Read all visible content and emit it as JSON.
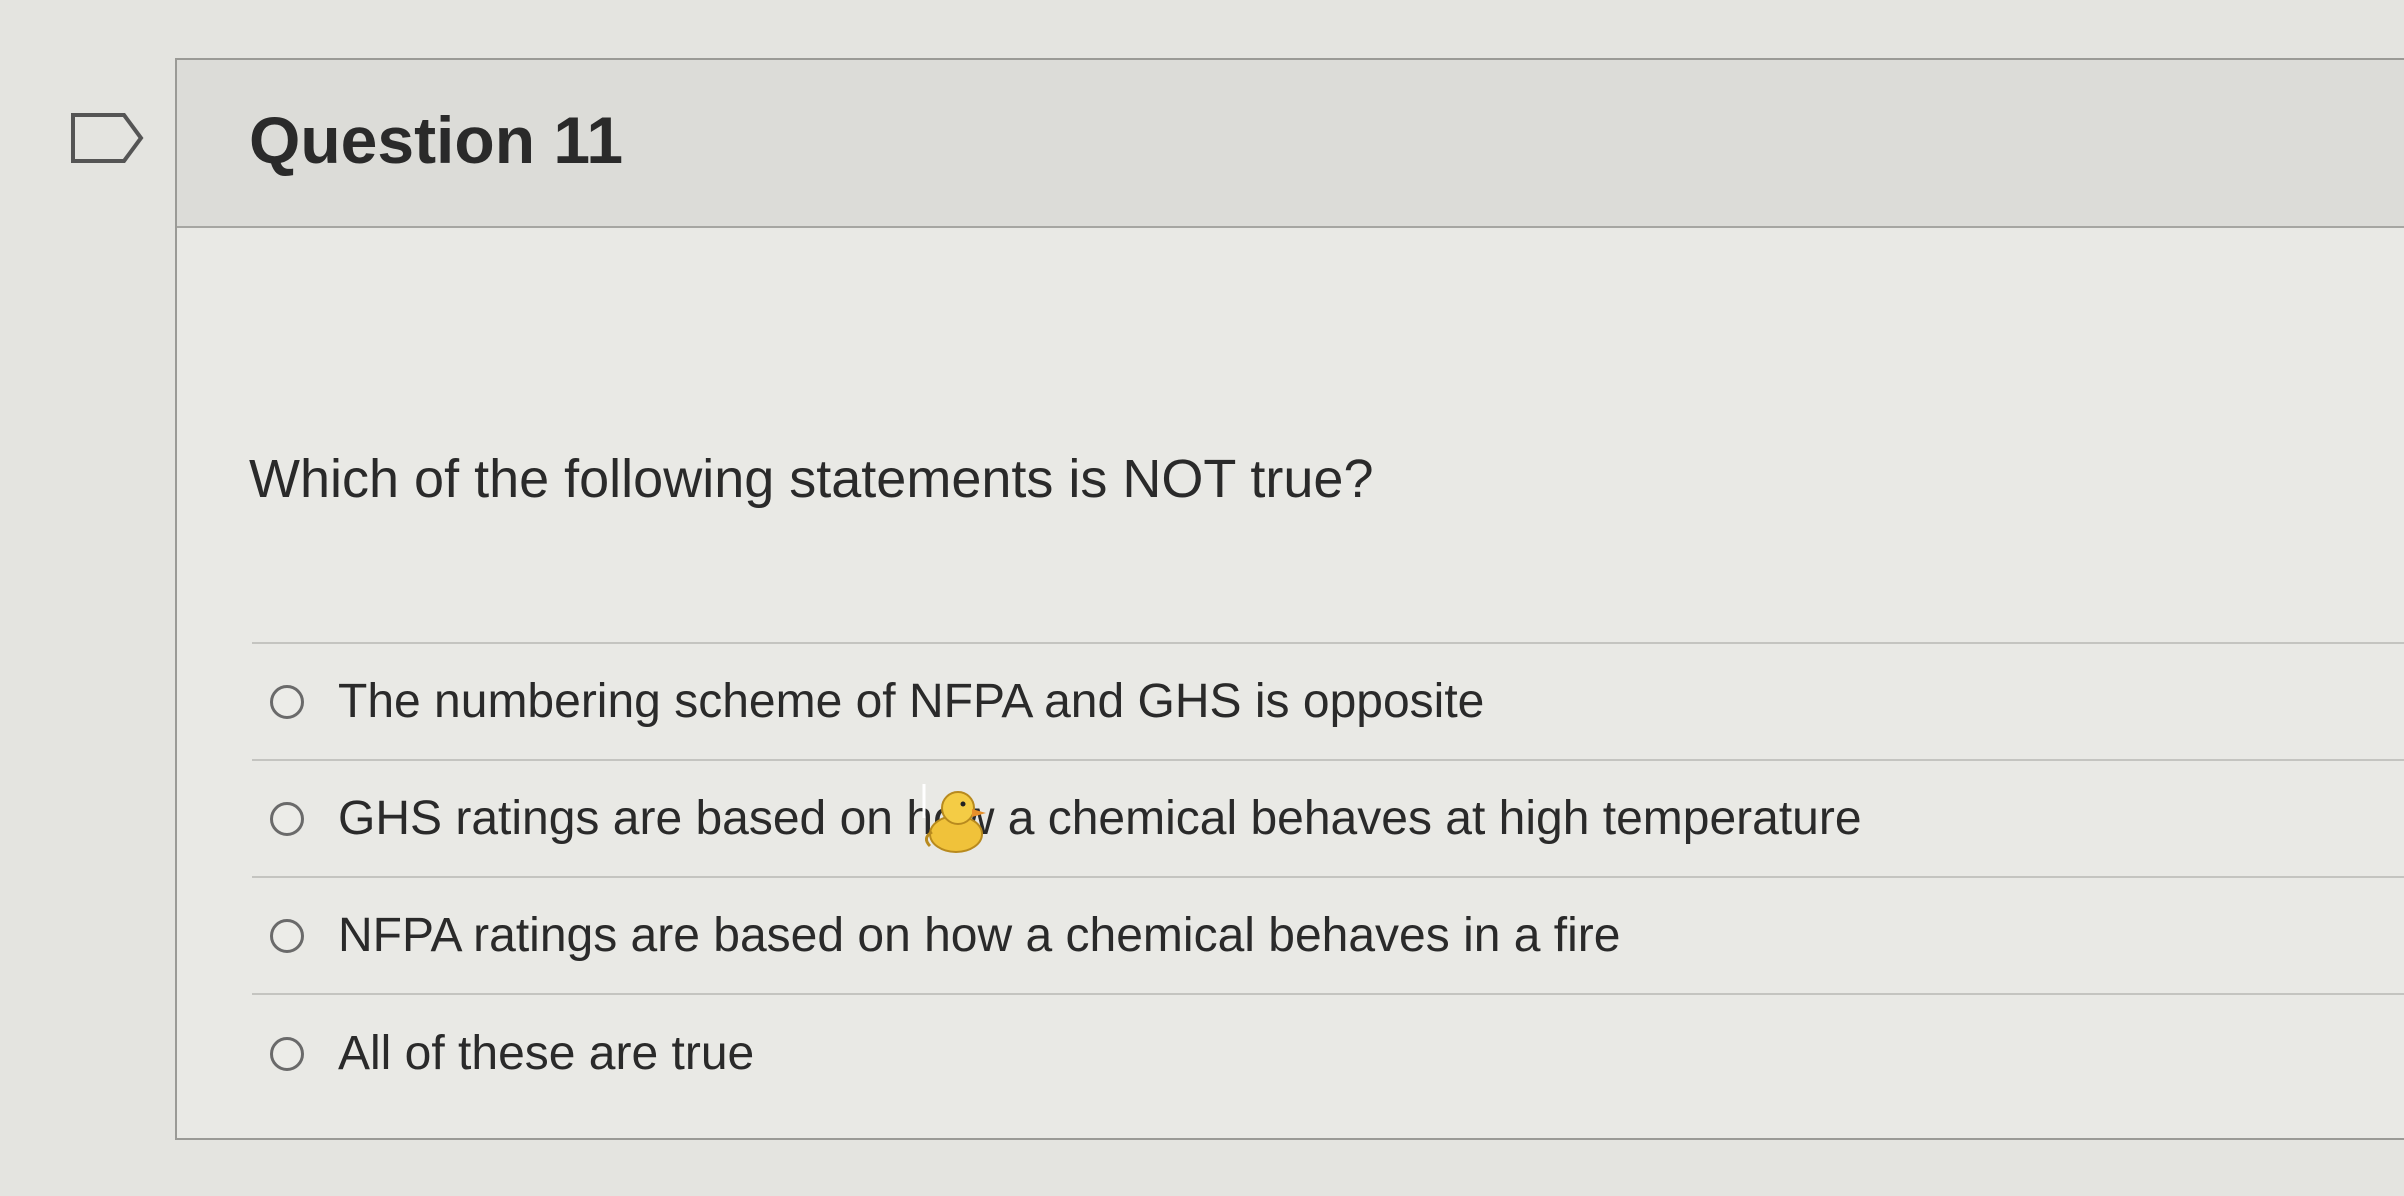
{
  "question": {
    "title": "Question 11",
    "prompt": "Which of the following statements is NOT true?"
  },
  "answers": [
    {
      "label": "The numbering scheme of NFPA and GHS is opposite",
      "selected": false
    },
    {
      "label": "GHS ratings are based on how a chemical behaves at high temperature",
      "selected": false
    },
    {
      "label": "NFPA ratings are based on how a chemical behaves in a fire",
      "selected": false
    },
    {
      "label": "All of these are true",
      "selected": false
    }
  ],
  "icons": {
    "flag": "flag-question-icon",
    "cursor": "duck-cursor-icon"
  },
  "colors": {
    "text": "#2a2a2a",
    "background": "#e4e4e0",
    "header": "#dcdcd8",
    "cursor_duck": "#f0c23a"
  }
}
